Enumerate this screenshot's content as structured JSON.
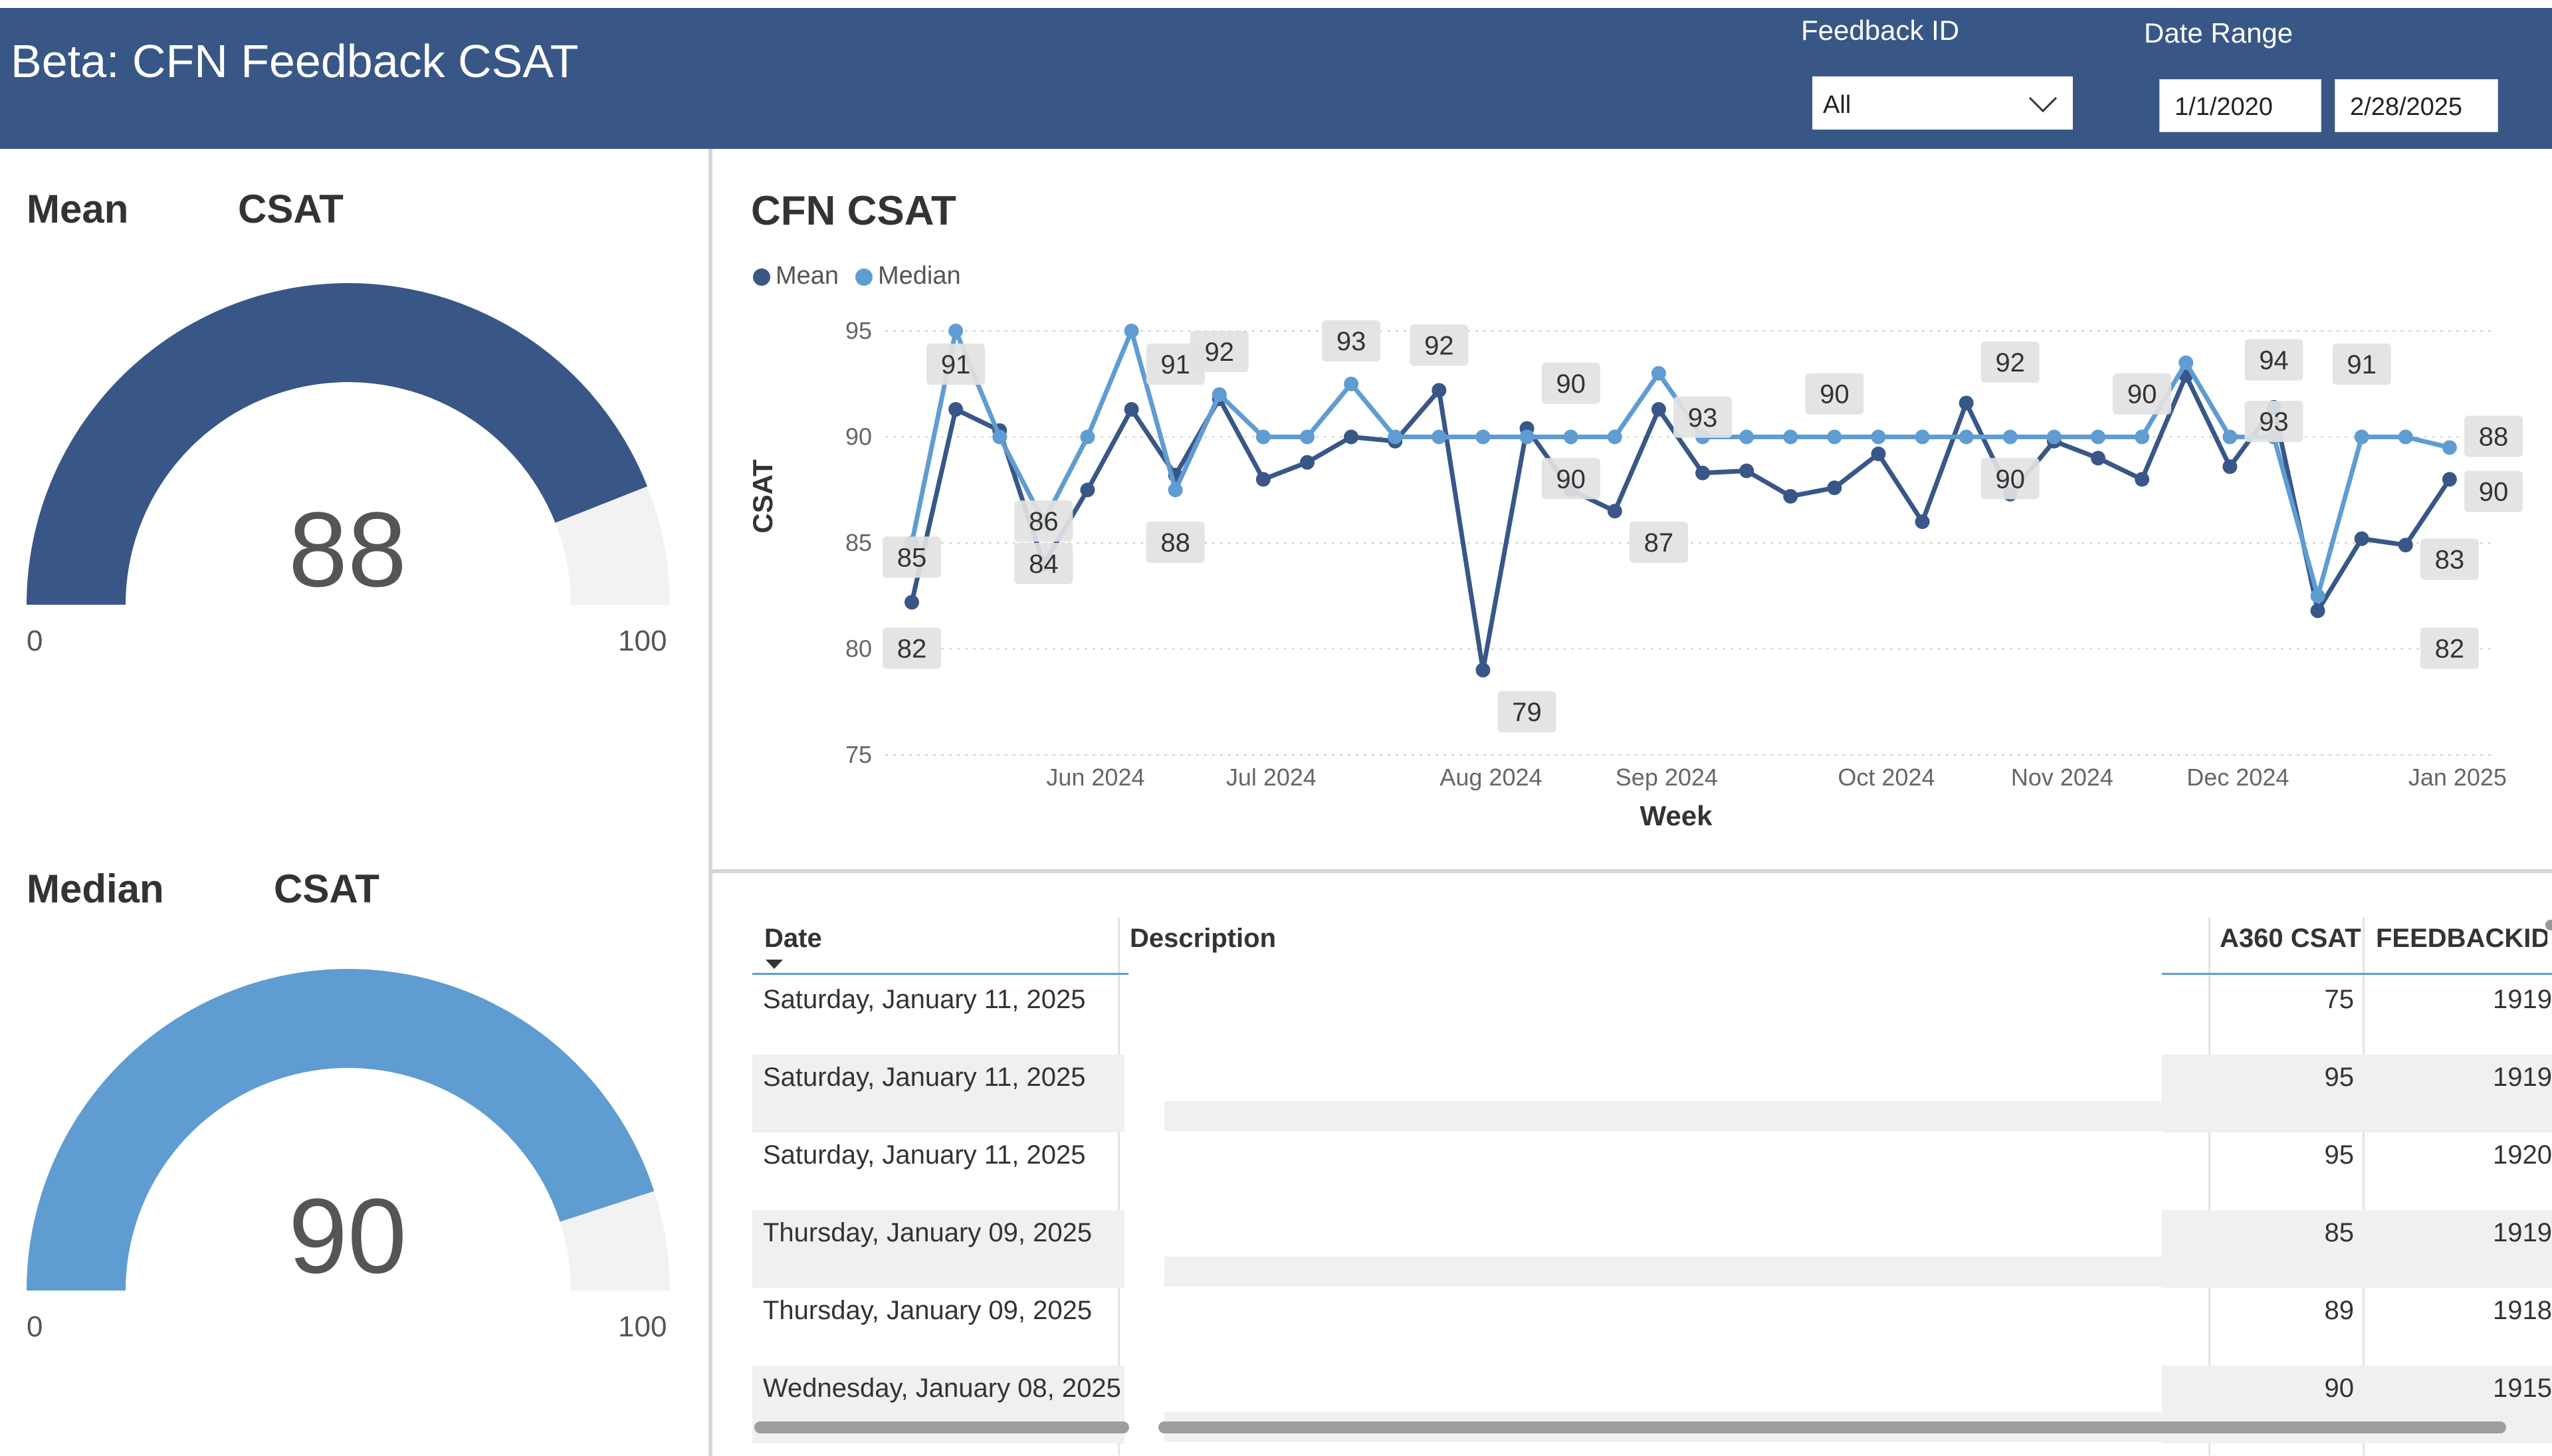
{
  "header": {
    "title": "Beta: CFN Feedback CSAT",
    "feedback_id_label": "Feedback ID",
    "feedback_id_value": "All",
    "date_range_label": "Date Range",
    "date_start": "1/1/2020",
    "date_end": "2/28/2025"
  },
  "gauges": [
    {
      "title_left": "Mean",
      "title_right": "CSAT",
      "value": "88",
      "min": "0",
      "max": "100",
      "fraction": 0.88,
      "color": "#385787"
    },
    {
      "title_left": "Median",
      "title_right": "CSAT",
      "value": "90",
      "min": "0",
      "max": "100",
      "fraction": 0.9,
      "color": "#5f9cd2"
    }
  ],
  "chart": {
    "title": "CFN CSAT",
    "legend": [
      {
        "name": "Mean",
        "color": "#385787"
      },
      {
        "name": "Median",
        "color": "#5f9cd2"
      }
    ]
  },
  "chart_data": {
    "type": "line",
    "title": "CFN CSAT",
    "xlabel": "Week",
    "ylabel": "CSAT",
    "ylim": [
      75,
      95
    ],
    "yticks": [
      75,
      80,
      85,
      90,
      95
    ],
    "x_tick_labels": [
      "Jun 2024",
      "Jul 2024",
      "Aug 2024",
      "Sep 2024",
      "Oct 2024",
      "Nov 2024",
      "Dec 2024",
      "Jan 2025"
    ],
    "x": [
      "2024-05-05",
      "2024-05-12",
      "2024-05-19",
      "2024-05-26",
      "2024-06-02",
      "2024-06-09",
      "2024-06-16",
      "2024-06-23",
      "2024-06-30",
      "2024-07-07",
      "2024-07-14",
      "2024-07-21",
      "2024-07-28",
      "2024-08-04",
      "2024-08-11",
      "2024-08-18",
      "2024-08-25",
      "2024-09-01",
      "2024-09-08",
      "2024-09-15",
      "2024-09-22",
      "2024-09-29",
      "2024-10-06",
      "2024-10-13",
      "2024-10-20",
      "2024-10-27",
      "2024-11-03",
      "2024-11-10",
      "2024-11-17",
      "2024-11-24",
      "2024-12-01",
      "2024-12-08",
      "2024-12-15",
      "2024-12-22",
      "2024-12-29",
      "2025-01-05",
      "2025-01-12"
    ],
    "series": [
      {
        "name": "Mean",
        "color": "#385787",
        "values": [
          82.2,
          91.3,
          90.3,
          84.0,
          87.5,
          91.3,
          88.2,
          91.8,
          88.0,
          88.8,
          90.0,
          89.8,
          92.2,
          79.0,
          90.4,
          87.5,
          86.5,
          91.3,
          88.3,
          88.4,
          87.2,
          87.6,
          89.2,
          86.0,
          91.6,
          87.3,
          89.8,
          89.0,
          88.0,
          92.9,
          88.6,
          91.4,
          81.8,
          85.2,
          84.9,
          88.0,
          null
        ]
      },
      {
        "name": "Median",
        "color": "#5f9cd2",
        "values": [
          85.0,
          95.0,
          90.0,
          86.0,
          90.0,
          95.0,
          87.5,
          92.0,
          90.0,
          90.0,
          92.5,
          90.0,
          90.0,
          90.0,
          90.0,
          90.0,
          90.0,
          93.0,
          90.0,
          90.0,
          90.0,
          90.0,
          90.0,
          90.0,
          90.0,
          90.0,
          90.0,
          90.0,
          90.0,
          93.5,
          90.0,
          90.0,
          82.5,
          90.0,
          90.0,
          89.5,
          null
        ]
      }
    ],
    "data_labels": [
      {
        "text": "85",
        "i": 0,
        "v": 84.3
      },
      {
        "text": "82",
        "i": 0,
        "v": 80.0
      },
      {
        "text": "91",
        "i": 1,
        "v": 93.4
      },
      {
        "text": "86",
        "i": 3,
        "v": 86.0
      },
      {
        "text": "84",
        "i": 3,
        "v": 84.0
      },
      {
        "text": "91",
        "i": 6,
        "v": 93.4
      },
      {
        "text": "88",
        "i": 6,
        "v": 85.0
      },
      {
        "text": "92",
        "i": 7,
        "v": 94.0
      },
      {
        "text": "93",
        "i": 10,
        "v": 94.5
      },
      {
        "text": "92",
        "i": 12,
        "v": 94.3
      },
      {
        "text": "79",
        "i": 14,
        "v": 77.0
      },
      {
        "text": "90",
        "i": 15,
        "v": 92.5
      },
      {
        "text": "90",
        "i": 15,
        "v": 88.0
      },
      {
        "text": "87",
        "i": 17,
        "v": 85.0
      },
      {
        "text": "93",
        "i": 18,
        "v": 90.9
      },
      {
        "text": "90",
        "i": 21,
        "v": 92.0
      },
      {
        "text": "90",
        "i": 25,
        "v": 88.0
      },
      {
        "text": "92",
        "i": 25,
        "v": 93.5
      },
      {
        "text": "90",
        "i": 28,
        "v": 92.0
      },
      {
        "text": "94",
        "i": 31,
        "v": 93.6
      },
      {
        "text": "93",
        "i": 31,
        "v": 90.7
      },
      {
        "text": "91",
        "i": 33,
        "v": 93.4
      },
      {
        "text": "83",
        "i": 35,
        "v": 84.2
      },
      {
        "text": "82",
        "i": 35,
        "v": 80.0
      },
      {
        "text": "88",
        "i": 38,
        "v": 90.0
      },
      {
        "text": "90",
        "i": 38,
        "v": 87.4
      }
    ]
  },
  "table": {
    "columns": [
      "Date",
      "Description",
      "A360 CSAT",
      "FEEDBACKID"
    ],
    "sort_icon": "sort-descending-icon",
    "rows": [
      {
        "date": "Saturday, January 11, 2025",
        "description": "",
        "csat": "75",
        "id": "1919"
      },
      {
        "date": "Saturday, January 11, 2025",
        "description": "",
        "csat": "95",
        "id": "1919"
      },
      {
        "date": "Saturday, January 11, 2025",
        "description": "",
        "csat": "95",
        "id": "1920"
      },
      {
        "date": "Thursday, January 09, 2025",
        "description": "",
        "csat": "85",
        "id": "1919"
      },
      {
        "date": "Thursday, January 09, 2025",
        "description": "",
        "csat": "89",
        "id": "1918"
      },
      {
        "date": "Wednesday, January 08, 2025",
        "description": "",
        "csat": "90",
        "id": "1915"
      }
    ]
  }
}
